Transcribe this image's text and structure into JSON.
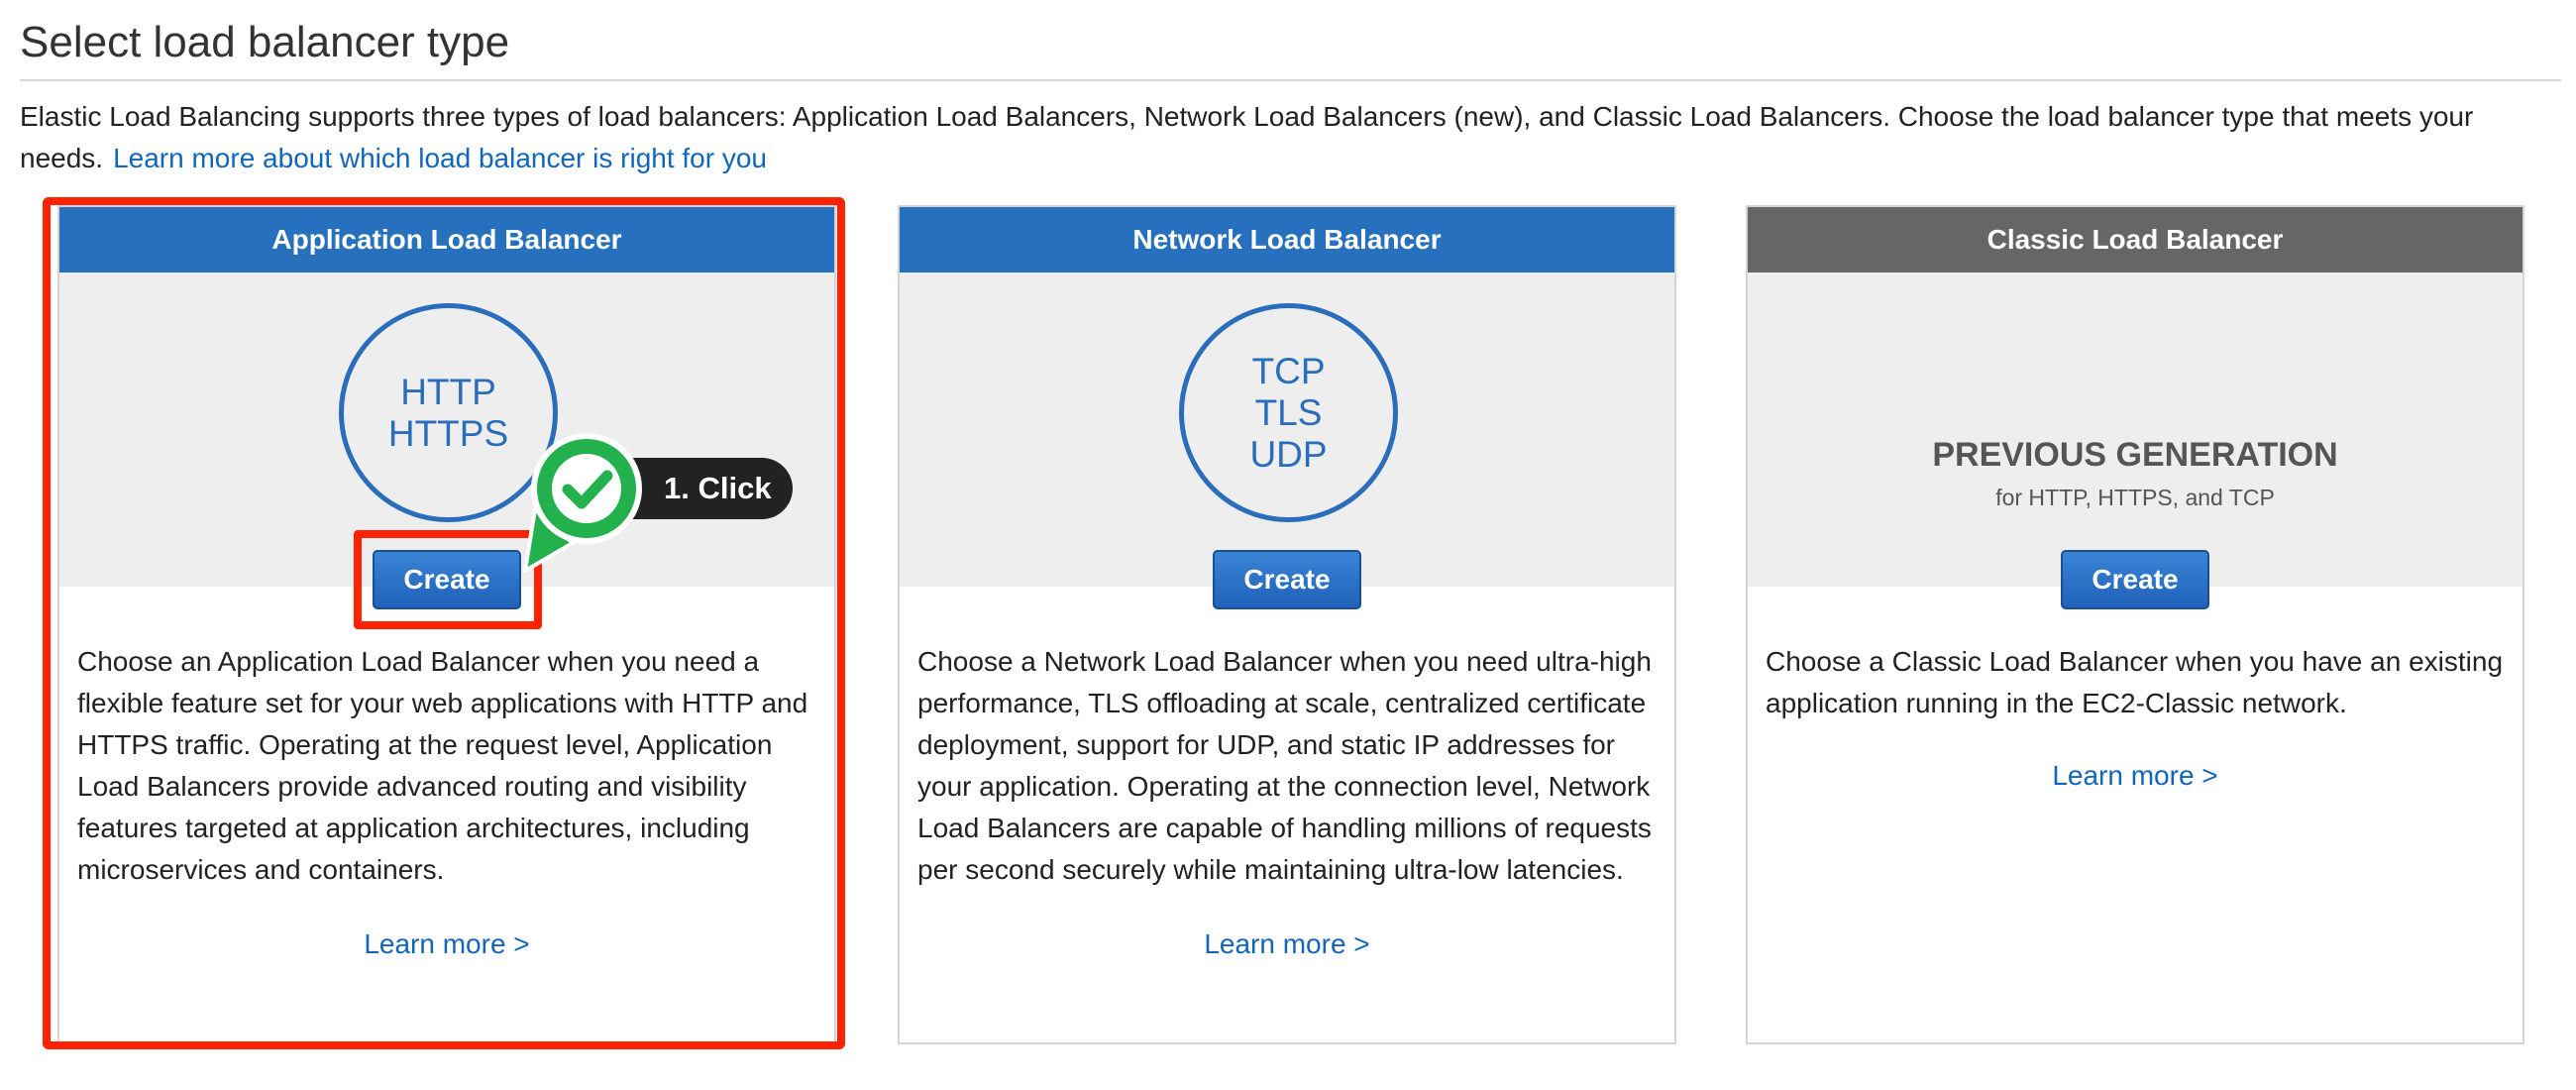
{
  "page": {
    "title": "Select load balancer type",
    "intro": "Elastic Load Balancing supports three types of load balancers: Application Load Balancers, Network Load Balancers (new), and Classic Load Balancers. Choose the load balancer type that meets your needs.",
    "intro_link": "Learn more about which load balancer is right for you"
  },
  "cards": [
    {
      "header": "Application Load Balancer",
      "protocols": [
        "HTTP",
        "HTTPS"
      ],
      "create_label": "Create",
      "description": "Choose an Application Load Balancer when you need a flexible feature set for your web applications with HTTP and HTTPS traffic. Operating at the request level, Application Load Balancers provide advanced routing and visibility features targeted at application architectures, including microservices and containers.",
      "learn_more": "Learn more >"
    },
    {
      "header": "Network Load Balancer",
      "protocols": [
        "TCP",
        "TLS",
        "UDP"
      ],
      "create_label": "Create",
      "description": "Choose a Network Load Balancer when you need ultra-high performance, TLS offloading at scale, centralized certificate deployment, support for UDP, and static IP addresses for your application. Operating at the connection level, Network Load Balancers are capable of handling millions of requests per second securely while maintaining ultra-low latencies.",
      "learn_more": "Learn more >"
    },
    {
      "header": "Classic Load Balancer",
      "badge": "PREVIOUS GENERATION",
      "badge_sub": "for HTTP, HTTPS, and TCP",
      "create_label": "Create",
      "description": "Choose a Classic Load Balancer when you have an existing application running in the EC2-Classic network.",
      "learn_more": "Learn more >"
    }
  ],
  "annotation": {
    "step_label": "1. Click"
  },
  "colors": {
    "header_blue": "#2670bd",
    "header_gray": "#666666",
    "link": "#1166bb",
    "highlight": "#ff2200",
    "check_green": "#22b14c"
  }
}
